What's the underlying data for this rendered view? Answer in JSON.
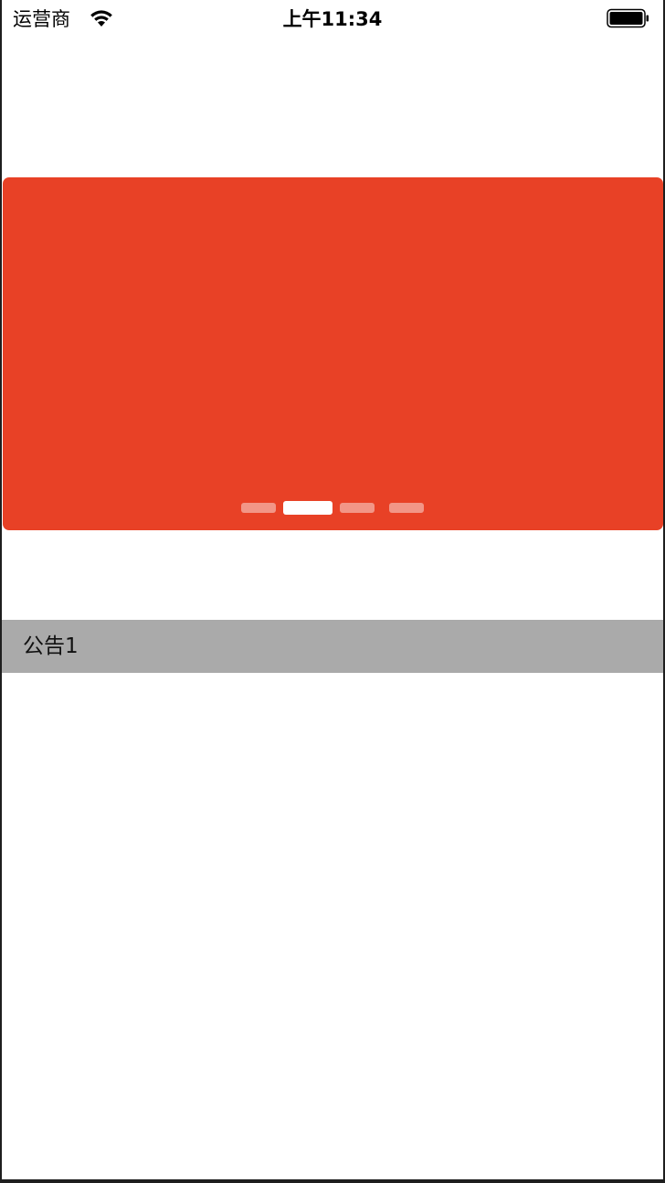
{
  "status_bar": {
    "carrier": "运营商",
    "time": "上午11:34",
    "wifi_icon": "wifi-icon",
    "battery_icon": "battery-icon",
    "battery_level": 1.0
  },
  "banner": {
    "background_color": "#e84126",
    "page_count": 4,
    "current_page": 2
  },
  "notice": {
    "text": "公告1",
    "background_color": "#aaaaaa"
  }
}
